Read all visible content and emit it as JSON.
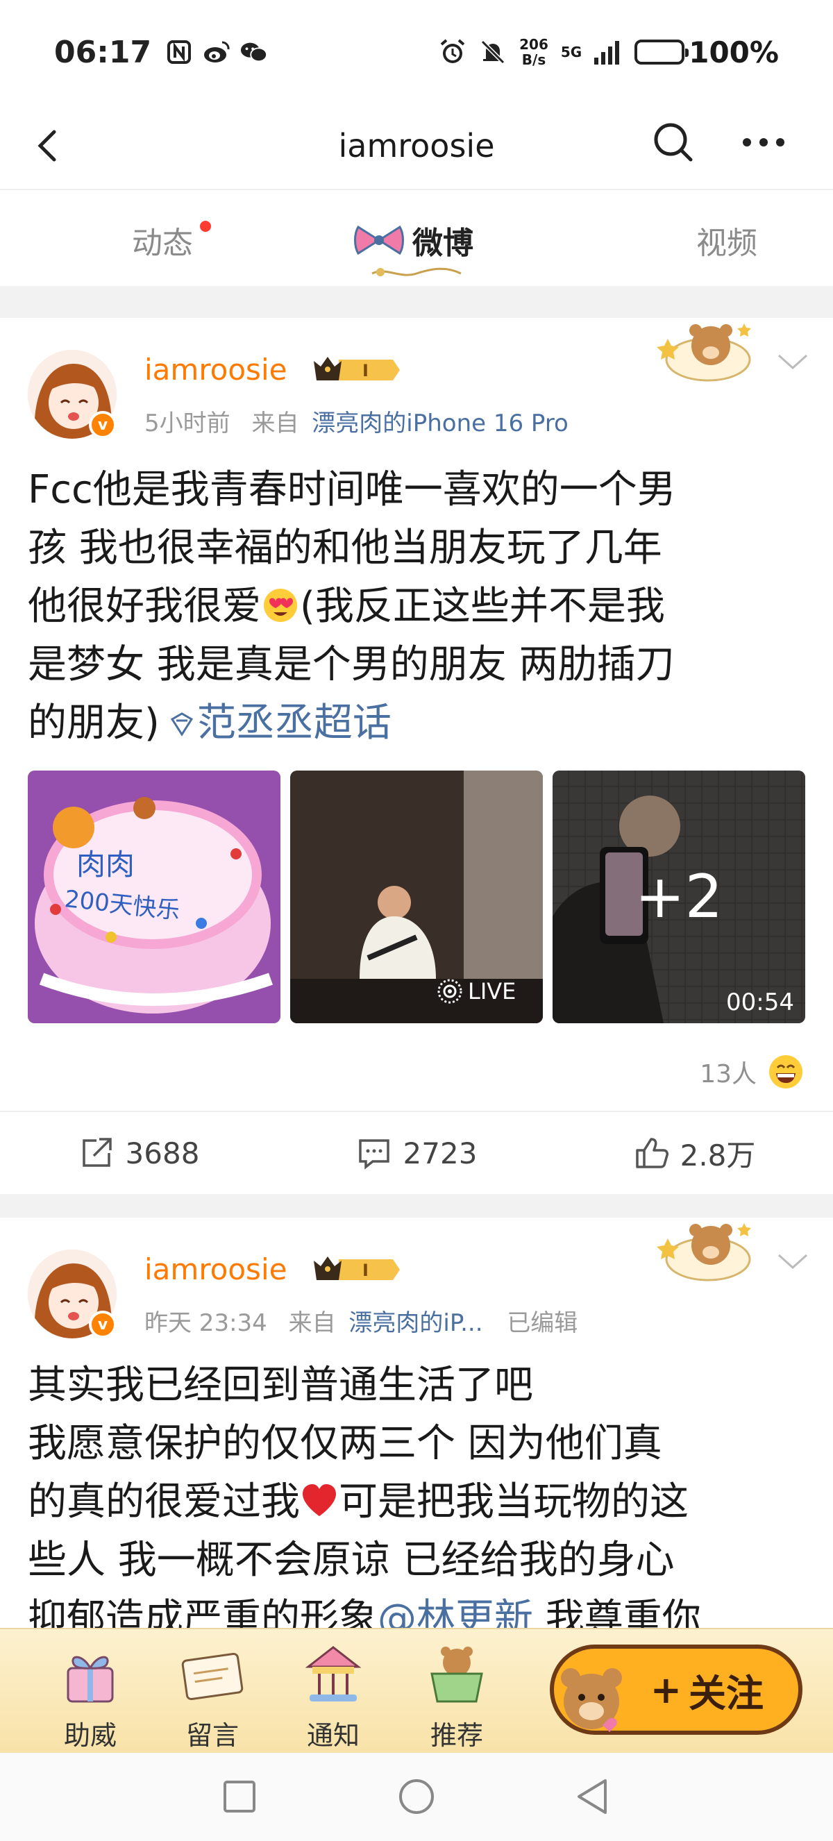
{
  "status_bar": {
    "time": "06:17",
    "net_speed_top": "206",
    "net_speed_bottom": "B/s",
    "network": "5G",
    "battery": "100%"
  },
  "header": {
    "title": "iamroosie"
  },
  "tabs": [
    {
      "label": "动态",
      "has_dot": true
    },
    {
      "label": "微博",
      "active": true
    },
    {
      "label": "视频"
    }
  ],
  "posts": [
    {
      "username": "iamroosie",
      "vip_level": "I",
      "time": "5小时前",
      "source_prefix": "来自",
      "source": "漂亮肉的iPhone 16 Pro",
      "text_lines": [
        "Fcc他是我青春时间唯一喜欢的一个男",
        "孩 我也很幸福的和他当朋友玩了几年",
        "他很好我很爱",
        "(我反正这些并不是我",
        "是梦女 我是真是个男的朋友 两肋插刀",
        "的朋友)"
      ],
      "topic": "范丞丞超话",
      "images": [
        {
          "cake_text_1": "肉肉",
          "cake_text_2": "200天快乐"
        },
        {
          "badge": "LIVE"
        },
        {
          "more": "+2",
          "duration": "00:54"
        }
      ],
      "reactions": "13人",
      "reposts": "3688",
      "comments": "2723",
      "likes": "2.8万"
    },
    {
      "username": "iamroosie",
      "vip_level": "I",
      "time": "昨天 23:34",
      "source_prefix": "来自",
      "source": "漂亮肉的iP...",
      "edited": "已编辑",
      "text_lines": [
        "其实我已经回到普通生活了吧",
        "我愿意保护的仅仅两三个 因为他们真",
        "的真的很爱过我",
        "可是把我当玩物的这",
        "些人 我一概不会原谅 已经给我的身心",
        "抑郁造成严重的形象",
        "@林更新",
        " 我尊重你"
      ]
    }
  ],
  "bottom_bar": {
    "items": [
      "助威",
      "留言",
      "通知",
      "推荐"
    ],
    "follow": "关注",
    "follow_plus": "+"
  },
  "colors": {
    "accent_orange": "#ff7a00",
    "link_blue": "#4a6fa1",
    "follow_gold": "#ffb020"
  }
}
